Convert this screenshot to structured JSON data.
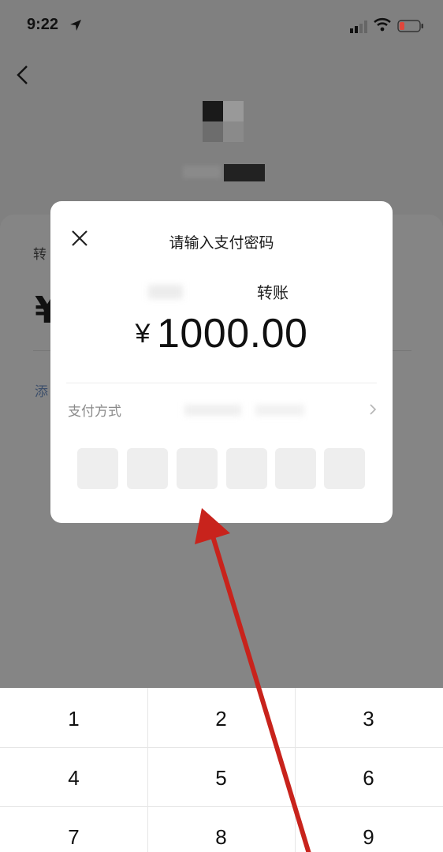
{
  "status_bar": {
    "time": "9:22",
    "icons": [
      "location-arrow-icon",
      "signal-icon",
      "wifi-icon",
      "battery-low-icon"
    ],
    "battery_color": "#e0473c"
  },
  "navigation": {
    "back_icon": "chevron-left-icon"
  },
  "background_page": {
    "transfer_label": "转",
    "currency_symbol": "¥",
    "add_note_text": "添"
  },
  "dialog": {
    "close_icon": "close-icon",
    "title": "请输入支付密码",
    "transfer_type": "转账",
    "currency": "¥",
    "amount": "1000.00",
    "payment_method_label": "支付方式",
    "payment_method_chevron": "chevron-right-icon",
    "password_length": 6
  },
  "keypad": {
    "keys": [
      "1",
      "2",
      "3",
      "4",
      "5",
      "6",
      "7",
      "8",
      "9"
    ]
  },
  "annotation": {
    "arrow_color": "#c8231c"
  }
}
